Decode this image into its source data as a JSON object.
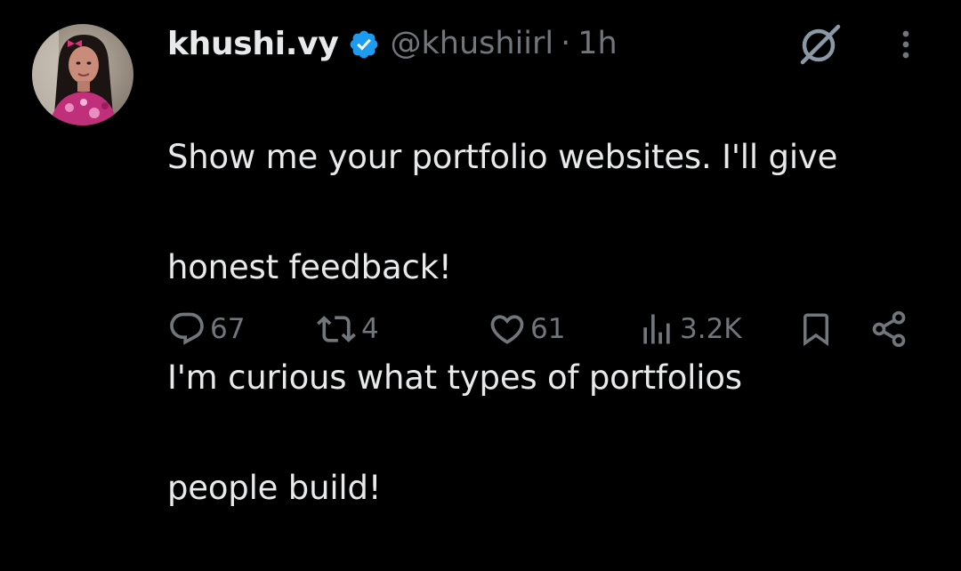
{
  "tweet": {
    "author": {
      "display_name": "khushi.vy",
      "handle": "@khushiirl",
      "verified": true
    },
    "separator": "·",
    "time": "1h",
    "text_lines": [
      "Show me your portfolio websites. I'll give",
      "honest feedback!",
      "I'm curious what types of portfolios",
      "people build!"
    ],
    "stats": {
      "replies": "67",
      "reposts": "4",
      "likes": "61",
      "views": "3.2K"
    }
  },
  "colors": {
    "background": "#000000",
    "text": "#e7e9ea",
    "secondary_text": "#71767b",
    "verified_badge": "#1d9bf0"
  },
  "icons": {
    "header": [
      "grok-icon",
      "more-icon"
    ],
    "actions": [
      "reply-icon",
      "repost-icon",
      "like-icon",
      "views-icon",
      "bookmark-icon",
      "share-icon"
    ]
  }
}
